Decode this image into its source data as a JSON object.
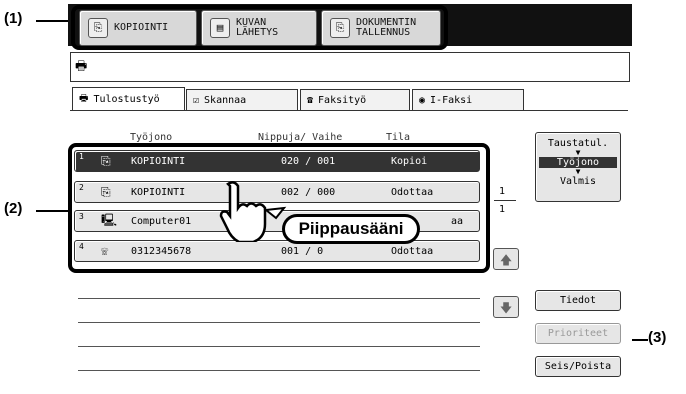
{
  "callouts": {
    "c1": "(1)",
    "c2": "(2)",
    "c3": "(3)"
  },
  "modes": [
    {
      "label": "KOPIOINTI",
      "icon": "copy-icon"
    },
    {
      "label": "KUVAN\nLÄHETYS",
      "icon": "image-send-icon"
    },
    {
      "label": "DOKUMENTIN\nTALLENNUS",
      "icon": "document-filing-icon"
    }
  ],
  "status_icon": "printer-icon",
  "tabs": [
    {
      "label": "Tulostustyö",
      "icon": "printer-icon"
    },
    {
      "label": "Skannaa",
      "icon": "scan-icon"
    },
    {
      "label": "Faksityö",
      "icon": "fax-icon"
    },
    {
      "label": "I-Faksi",
      "icon": "internet-fax-icon"
    }
  ],
  "columns": {
    "queue": "Työjono",
    "sets": "Nippuja/ Vaihe",
    "status": "Tila"
  },
  "jobs": [
    {
      "num": "1",
      "icon": "copy-icon",
      "name": "KOPIOINTI",
      "count": "020 / 001",
      "status": "Kopioi"
    },
    {
      "num": "2",
      "icon": "copy-icon",
      "name": "KOPIOINTI",
      "count": "002 / 000",
      "status": "Odottaa"
    },
    {
      "num": "3",
      "icon": "computer-icon",
      "name": "Computer01",
      "count": "",
      "status": "aa"
    },
    {
      "num": "4",
      "icon": "fax-phone-icon",
      "name": "0312345678",
      "count": "001 / 0",
      "status": "Odottaa"
    }
  ],
  "view_button": {
    "line1": "Taustatul.",
    "line2": "Työjono",
    "line3": "Valmis"
  },
  "page": {
    "current": "1",
    "total": "1"
  },
  "buttons": {
    "details": "Tiedot",
    "priority": "Prioriteet",
    "stop_delete": "Seis/Poista"
  },
  "bubble": "Piippausääni"
}
